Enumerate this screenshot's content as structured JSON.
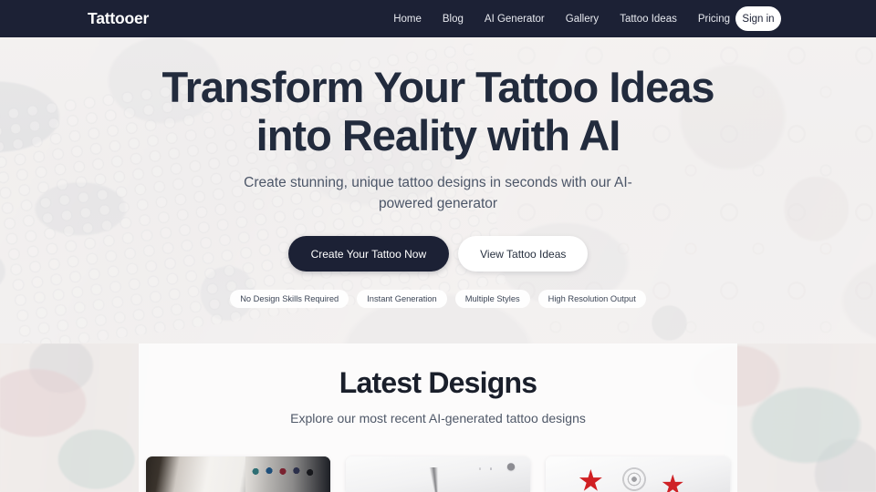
{
  "navbar": {
    "brand": "Tattooer",
    "links": [
      {
        "label": "Home"
      },
      {
        "label": "Blog"
      },
      {
        "label": "AI Generator"
      },
      {
        "label": "Gallery"
      },
      {
        "label": "Tattoo Ideas"
      },
      {
        "label": "Pricing"
      }
    ],
    "signin_label": "Sign in",
    "background_color": "#1c2135",
    "text_color": "#e7e9ef"
  },
  "hero": {
    "title": "Transform Your Tattoo Ideas into Reality with AI",
    "subtitle": "Create stunning, unique tattoo designs in seconds with our AI-powered generator",
    "primary_cta": "Create Your Tattoo Now",
    "secondary_cta": "View Tattoo Ideas",
    "pills": [
      {
        "label": "No Design Skills Required"
      },
      {
        "label": "Instant Generation"
      },
      {
        "label": "Multiple Styles"
      },
      {
        "label": "High Resolution Output"
      }
    ],
    "title_color": "#222b3d",
    "primary_cta_color": "#1c2135"
  },
  "designs": {
    "title": "Latest Designs",
    "subtitle": "Explore our most recent AI-generated tattoo designs",
    "cards": [
      {
        "alt": "artist-hand-drawing-with-watercolor-palette"
      },
      {
        "alt": "ornamental-black-linework-tattoo-sketch"
      },
      {
        "alt": "red-stars-and-rose-tattoo-design"
      }
    ]
  }
}
